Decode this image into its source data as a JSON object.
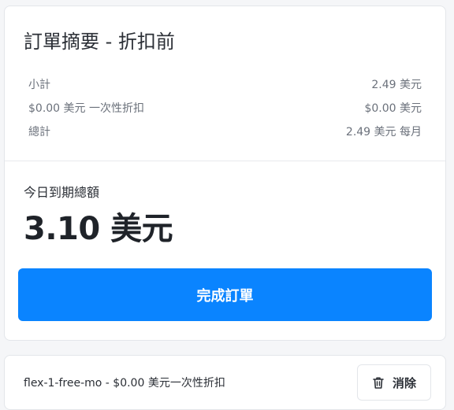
{
  "summary": {
    "title": "訂單摘要 - 折扣前",
    "rows": [
      {
        "label": "小計",
        "value": "2.49 美元"
      },
      {
        "label": "$0.00 美元 一次性折扣",
        "value": "$0.00 美元"
      },
      {
        "label": "總計",
        "value": "2.49 美元 每月"
      }
    ],
    "due_today_label": "今日到期總額",
    "due_today_amount": "3.10 美元",
    "complete_button_label": "完成訂單"
  },
  "coupon": {
    "text": "flex-1-free-mo - $0.00 美元一次性折扣",
    "remove_label": "消除",
    "remove_icon": "trash-icon"
  },
  "colors": {
    "accent": "#0a84ff",
    "background": "#f5f6f8",
    "card": "#ffffff"
  }
}
